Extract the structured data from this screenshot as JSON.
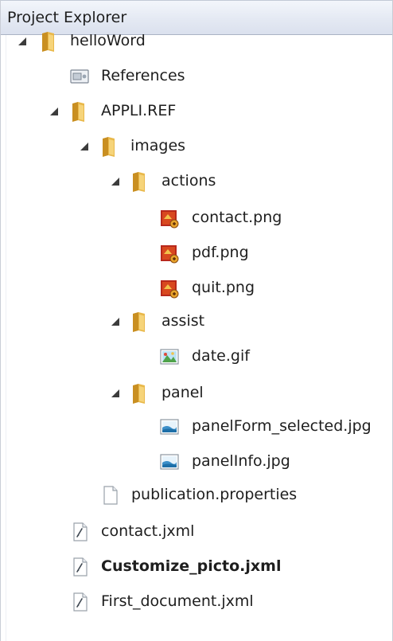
{
  "panel": {
    "title": "Project Explorer"
  },
  "tree": {
    "items": [
      {
        "label": "helloWord",
        "icon": "folder-icon",
        "expanded": true,
        "bold": false
      },
      {
        "label": "References",
        "icon": "references-icon",
        "bold": false
      },
      {
        "label": "APPLI.REF",
        "icon": "folder-icon",
        "expanded": true,
        "bold": false
      },
      {
        "label": "images",
        "icon": "folder-icon",
        "expanded": true,
        "bold": false
      },
      {
        "label": "actions",
        "icon": "folder-icon",
        "expanded": true,
        "bold": false
      },
      {
        "label": "contact.png",
        "icon": "png-image-icon",
        "bold": false
      },
      {
        "label": "pdf.png",
        "icon": "png-image-icon",
        "bold": false
      },
      {
        "label": "quit.png",
        "icon": "png-image-icon",
        "bold": false
      },
      {
        "label": "assist",
        "icon": "folder-icon",
        "expanded": true,
        "bold": false
      },
      {
        "label": "date.gif",
        "icon": "gif-image-icon",
        "bold": false
      },
      {
        "label": "panel",
        "icon": "folder-icon",
        "expanded": true,
        "bold": false
      },
      {
        "label": "panelForm_selected.jpg",
        "icon": "jpg-image-icon",
        "bold": false
      },
      {
        "label": "panelInfo.jpg",
        "icon": "jpg-image-icon",
        "bold": false
      },
      {
        "label": "publication.properties",
        "icon": "text-file-icon",
        "bold": false
      },
      {
        "label": "contact.jxml",
        "icon": "jxml-file-icon",
        "bold": false
      },
      {
        "label": "Customize_picto.jxml",
        "icon": "jxml-file-icon",
        "bold": true
      },
      {
        "label": "First_document.jxml",
        "icon": "jxml-file-icon",
        "bold": false
      }
    ]
  },
  "colors": {
    "folder": "#e9b84a",
    "title_bar": "#dbe1ee",
    "text": "#1e1e1e"
  }
}
